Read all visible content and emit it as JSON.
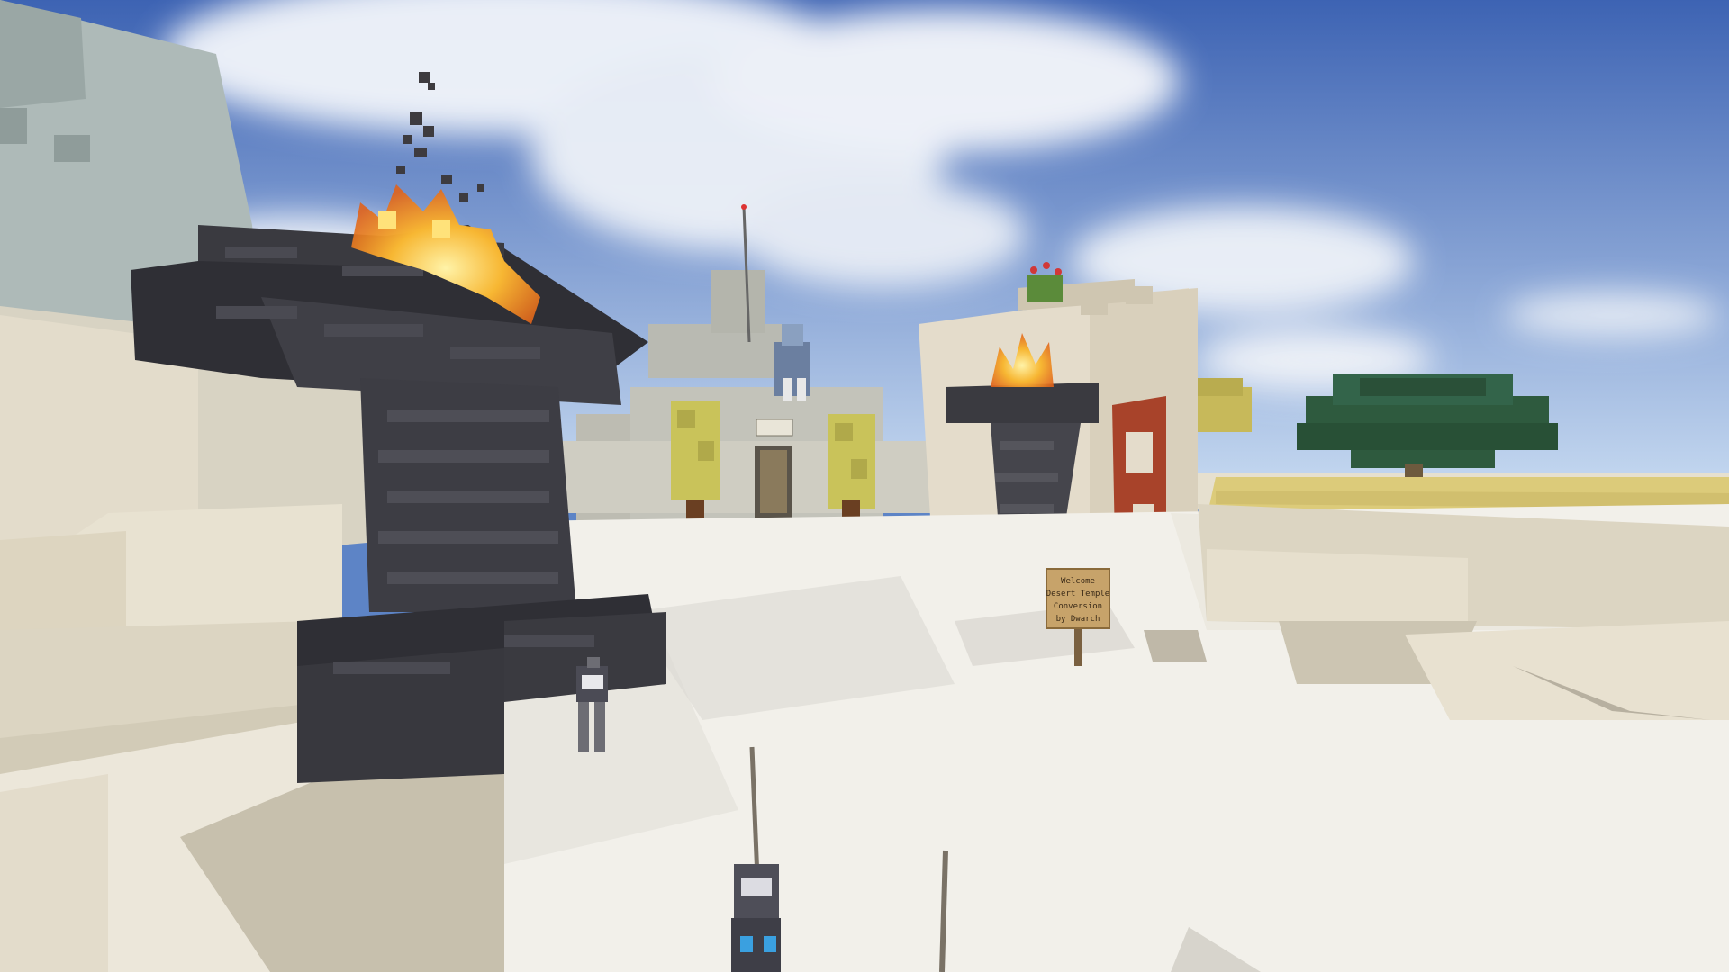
{
  "game": {
    "title": "",
    "view": "first-person",
    "biome": "desert",
    "time_of_day": "day"
  },
  "world": {
    "sky": {
      "top_color": "#3d63b3",
      "bottom_color": "#c9dcf2",
      "cloud_color": "#f3f6fb"
    },
    "blocks": [
      "sandstone",
      "smooth-sandstone",
      "white-sand",
      "deepslate-bricks",
      "stone-bricks",
      "red-sandstone",
      "oak-leaves",
      "hay-field"
    ],
    "colors": {
      "sand": "#f2f0ea",
      "sandstone": "#e2d6bd",
      "sandstone_shadow": "#c9bfa8",
      "deepslate": "#3a3a40",
      "deepslate_light": "#55555c",
      "stone_brick": "#b7b6ad",
      "red_sandstone": "#a8432a",
      "leaves": "#c9c35a",
      "tree": "#2e5a3e",
      "fire": "#f5a623",
      "fire_core": "#ffe27a",
      "wheat": "#dccb7a"
    }
  },
  "sign": {
    "lines": [
      "Welcome",
      "Desert Temple",
      "Conversion",
      "by Dwarch"
    ]
  },
  "entities": [
    {
      "name": "armor-stand-left",
      "type": "armor-stand"
    },
    {
      "name": "armor-stand-roof",
      "type": "armor-stand"
    },
    {
      "name": "player-held-item",
      "type": "item"
    }
  ]
}
